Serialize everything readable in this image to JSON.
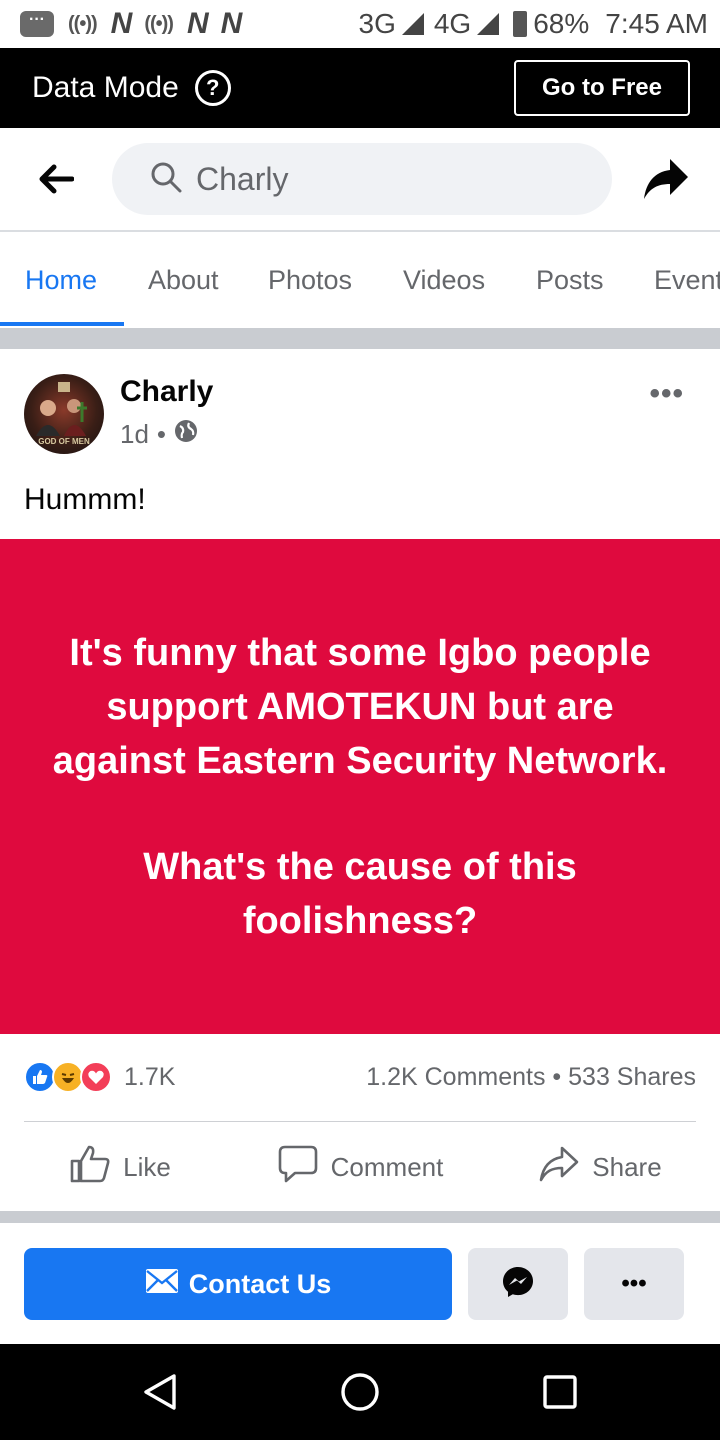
{
  "status_bar": {
    "network_3g": "3G",
    "network_4g": "4G",
    "battery": "68%",
    "time": "7:45 AM"
  },
  "data_mode": {
    "title": "Data Mode",
    "go_free_label": "Go to Free"
  },
  "search": {
    "query": "Charly"
  },
  "tabs": [
    {
      "label": "Home",
      "active": true
    },
    {
      "label": "About",
      "active": false
    },
    {
      "label": "Photos",
      "active": false
    },
    {
      "label": "Videos",
      "active": false
    },
    {
      "label": "Posts",
      "active": false
    },
    {
      "label": "Events",
      "active": false
    }
  ],
  "post": {
    "author": "Charly",
    "age": "1d",
    "separator": "•",
    "avatar_caption": "GOD OF MEN",
    "text": "Hummm!",
    "image_text": {
      "paragraph1": "It's funny that some Igbo people support AMOTEKUN but are against Eastern Security Network.",
      "paragraph2": "What's the cause of this foolishness?"
    },
    "image_background": "#df0a3e",
    "reaction_count": "1.7K",
    "comments_shares": "1.2K Comments • 533 Shares",
    "actions": {
      "like": "Like",
      "comment": "Comment",
      "share": "Share"
    }
  },
  "page_actions": {
    "contact_label": "Contact Us",
    "more_label": "•••"
  },
  "colors": {
    "accent": "#1877f2",
    "image_red": "#df0a3e"
  }
}
